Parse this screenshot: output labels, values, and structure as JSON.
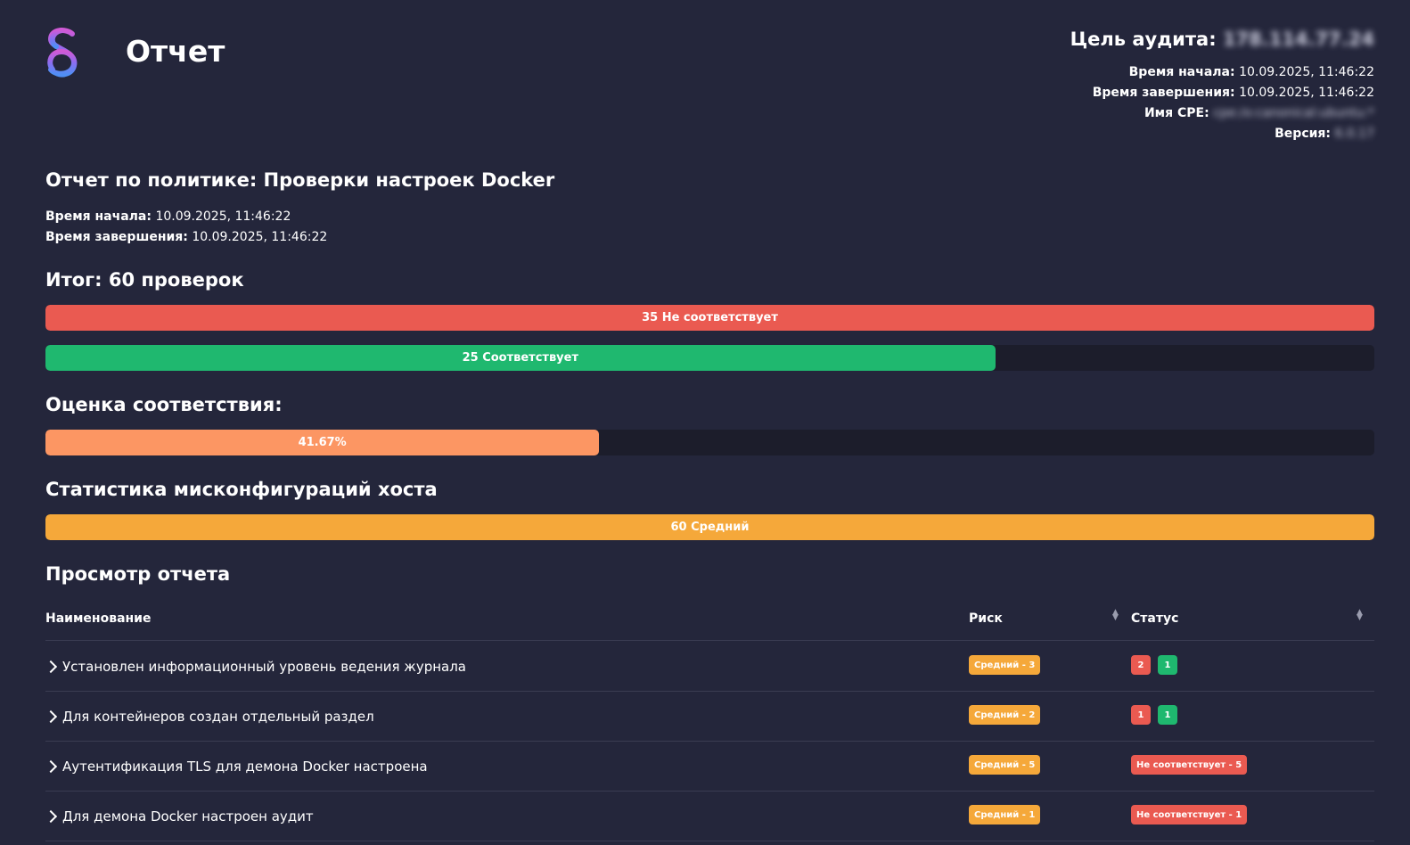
{
  "header": {
    "title": "Отчет",
    "target_label": "Цель аудита:",
    "target_value": "178.114.77.24",
    "start_label": "Время начала:",
    "start_value": "10.09.2025, 11:46:22",
    "end_label": "Время завершения:",
    "end_value": "10.09.2025, 11:46:22",
    "cpe_label": "Имя CPE:",
    "cpe_value": "cpe:/o:canonical:ubuntu:*",
    "version_label": "Версия:",
    "version_value": "6.0.17"
  },
  "policy": {
    "title": "Отчет по политике: Проверки настроек Docker",
    "start_label": "Время начала:",
    "start_value": "10.09.2025, 11:46:22",
    "end_label": "Время завершения:",
    "end_value": "10.09.2025, 11:46:22"
  },
  "summary": {
    "title": "Итог: 60 проверок",
    "total": 60,
    "fail_label": "35 Не соответствует",
    "fail_fraction": 1.0,
    "pass_label": "25 Соответствует",
    "pass_fraction": 0.7147
  },
  "score": {
    "title": "Оценка соответствия:",
    "label": "41.67%",
    "fraction": 0.4167
  },
  "stats": {
    "title": "Статистика мисконфигураций хоста",
    "label": "60 Средний",
    "fraction": 1.0
  },
  "review": {
    "title": "Просмотр отчета",
    "columns": {
      "name": "Наименование",
      "risk": "Риск",
      "status": "Статус"
    },
    "rows": [
      {
        "name": "Установлен информационный уровень ведения журнала",
        "risk": "Средний - 3",
        "fail_count": "2",
        "pass_count": "1"
      },
      {
        "name": "Для контейнеров создан отдельный раздел",
        "risk": "Средний - 2",
        "fail_count": "1",
        "pass_count": "1"
      },
      {
        "name": "Аутентификация TLS для демона Docker настроена",
        "risk": "Средний - 5",
        "status": "Не соответствует - 5"
      },
      {
        "name": "Для демона Docker настроен аудит",
        "risk": "Средний - 1",
        "status": "Не соответствует - 1"
      }
    ]
  },
  "colors": {
    "background": "#24263b",
    "fail": "#ea5a51",
    "pass": "#1fb86f",
    "score": "#fc9663",
    "medium": "#f5a83a"
  }
}
